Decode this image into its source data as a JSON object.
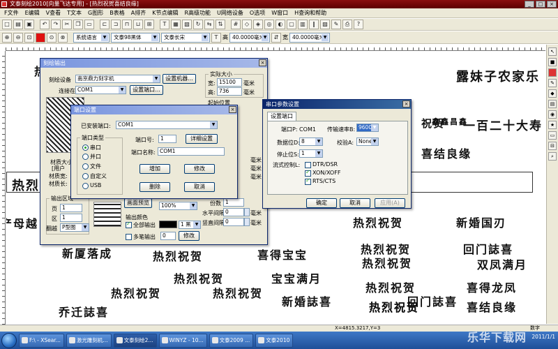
{
  "app": {
    "title": "文泰刻绘2010[向量飞达专用] - [热烈祝贺喜结良缘]"
  },
  "menu": [
    "F文件",
    "E编辑",
    "V查看",
    "T文本",
    "G图形",
    "B表格",
    "A排齐",
    "K节点编辑",
    "R高级功能",
    "U网络设备",
    "O选项",
    "W窗口",
    "H查询和帮助"
  ],
  "toolbar2": {
    "font_lang": "系统语言",
    "font_name": "文泰98黑体",
    "font_style": "文泰长宋",
    "height_label": "高",
    "height_value": "40.0000毫米",
    "width_label": "宽",
    "width_value": "40.0000毫米"
  },
  "canvas_texts": [
    "露妹子农家乐",
    "祝贺",
    "鑫鑫昌鑫",
    "一百二十大寿",
    "喜结良缘",
    "热烈",
    "产母越",
    "热烈祝贺",
    "新婚国刃",
    "新厦落成",
    "热烈祝贺",
    "喜得宝宝",
    "热烈祝贺",
    "回门誌喜",
    "热烈祝贺",
    "双凤满月",
    "热烈祝贺",
    "热烈祝贺",
    "宝宝满月",
    "热烈祝贺",
    "喜得龙凤",
    "热烈祝贺",
    "新婚誌喜",
    "回门誌喜",
    "热烈祝贺",
    "乔迁誌喜",
    "热烈祝贺",
    "喜结良缘",
    "热烈",
    "烙"
  ],
  "status": {
    "coords": "X=4815.3217,Y=3",
    "caps": "数字"
  },
  "taskbar": {
    "tasks": [
      "F:\\ - XSear...",
      "激光雕刻机...",
      "文泰刻绘2...",
      "WINYZ - 10...",
      "文泰2009 ...",
      "文泰2010"
    ],
    "tray_time": "2011/1/1"
  },
  "watermark": "乐华下载网",
  "engrave_dialog": {
    "title": "刻绘输出",
    "device_setting_label": "刻绘设备",
    "device_value": "南京鼎力刻字机",
    "device_setting_btn": "设置机器...",
    "connect_label": "连接在",
    "connect_value": "COM1",
    "port_setting_btn": "设置端口...",
    "actual_size_group": "实际大小",
    "width_label": "宽:",
    "width_value": "15100",
    "height_label": "高:",
    "height_value": "736",
    "unit": "毫米",
    "start_pos_group": "起始位置",
    "material_group": "材质大小",
    "material_width_label": "材质宽:",
    "material_length_label": "材质长:",
    "user_label": "[用户",
    "output_area_group": "输出区域",
    "page_label": "页",
    "page_value": "1",
    "region_label": "区",
    "region_value": "1",
    "rotate_label": "翻越",
    "rotate_value": "P型图",
    "preview_btn": "画面预览",
    "scale_value": "100%",
    "output_color_group": "输出颜色",
    "all_output_label": "全部输出",
    "color_value": "1 黑",
    "multi_output_label": "多笔输出",
    "multi_value": "0",
    "modify_btn": "修改",
    "copies_label": "份数",
    "copies_value": "1",
    "h_spacing_label": "水平间隔",
    "h_spacing_value": "0",
    "v_spacing_label": "竖直间隔",
    "v_spacing_value": "0"
  },
  "port_dialog": {
    "title": "端口设置",
    "installed_label": "已安装端口:",
    "installed_value": "COM1",
    "type_group": "端口类型",
    "types": [
      "串口",
      "并口",
      "文件",
      "自定义",
      "USB"
    ],
    "port_no_label": "端口号:",
    "port_no_value": "1",
    "detail_btn": "详细设置",
    "port_name_label": "端口名称:",
    "port_name_value": "COM1",
    "add_btn": "增加",
    "modify_btn": "修改",
    "delete_btn": "删除",
    "cancel_btn": "取消"
  },
  "serial_dialog": {
    "title": "串口参数设置",
    "tab_label": "设置端口",
    "port_label": "端口P: COM1",
    "baud_label": "传输速率B:",
    "baud_value": "9600",
    "data_bits_label": "数据位D:",
    "data_bits_value": "8",
    "parity_label": "校验A:",
    "parity_value": "None",
    "stop_bits_label": "停止位S:",
    "stop_bits_value": "1",
    "flow_label": "流式控制L:",
    "flow_opts": [
      "DTR/DSR",
      "XON/XOFF",
      "RTS/CTS"
    ],
    "ok_btn": "确定",
    "cancel_btn": "取消",
    "apply_btn": "应用(A)"
  },
  "colors": {
    "title_accent": "#0a246a",
    "app_titlebar": "#8a1010",
    "taskbar": "#2a5fae",
    "dialog_bg": "#ece9d8"
  }
}
